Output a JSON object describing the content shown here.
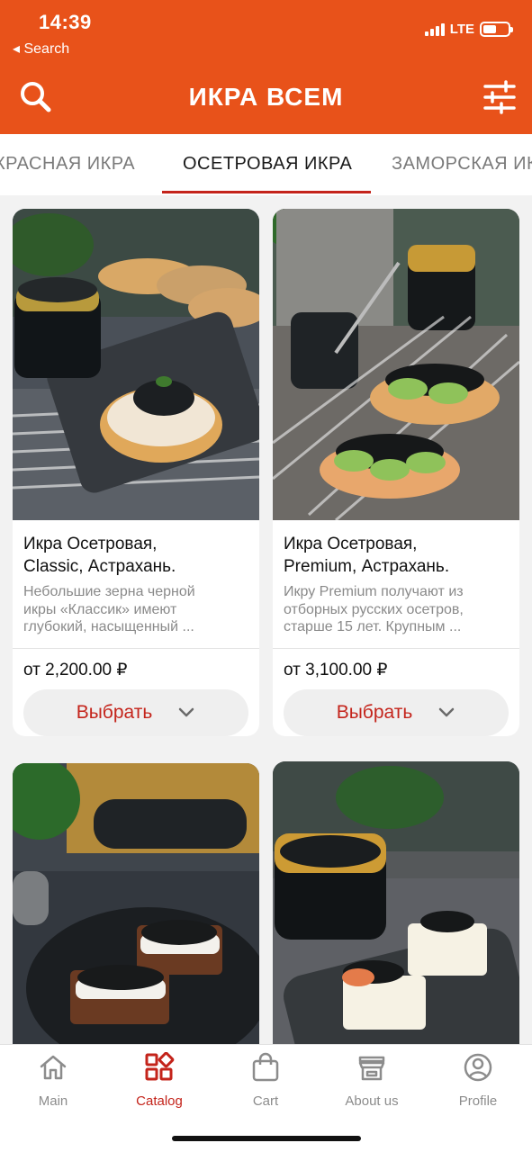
{
  "status_bar": {
    "time": "14:39",
    "back_label": "◂ Search",
    "network": "LTE",
    "battery_level": 0.55
  },
  "header": {
    "title": "ИКРА ВСЕМ",
    "search_icon": "search-icon",
    "filter_icon": "filter-icon"
  },
  "tabs": [
    {
      "label": "КРАСНАЯ ИКРА",
      "active": false
    },
    {
      "label": "ОСЕТРОВАЯ ИКРА",
      "active": true
    },
    {
      "label": "ЗАМОРСКАЯ ИКРА",
      "active": false
    }
  ],
  "products": [
    {
      "title_line1": "Икра Осетровая,",
      "title_line2": "Classic, Астрахань.",
      "desc_line1": "Небольшие зерна черной",
      "desc_line2": "икры «Классик» имеют",
      "desc_line3": "глубокий, насыщенный ...",
      "price": "от 2,200.00 ₽",
      "button": "Выбрать"
    },
    {
      "title_line1": "Икра Осетровая,",
      "title_line2": "Premium, Астрахань.",
      "desc_line1": "Икру Premium получают из",
      "desc_line2": "отборных русских осетров,",
      "desc_line3": "старше 15 лет. Крупным ...",
      "price": "от 3,100.00 ₽",
      "button": "Выбрать"
    }
  ],
  "bottom_nav": [
    {
      "label": "Main",
      "icon": "home-icon",
      "active": false
    },
    {
      "label": "Catalog",
      "icon": "catalog-icon",
      "active": true
    },
    {
      "label": "Cart",
      "icon": "cart-icon",
      "active": false
    },
    {
      "label": "About us",
      "icon": "store-icon",
      "active": false
    },
    {
      "label": "Profile",
      "icon": "profile-icon",
      "active": false
    }
  ],
  "colors": {
    "brand": "#e8521a",
    "accent": "#c4241b"
  }
}
